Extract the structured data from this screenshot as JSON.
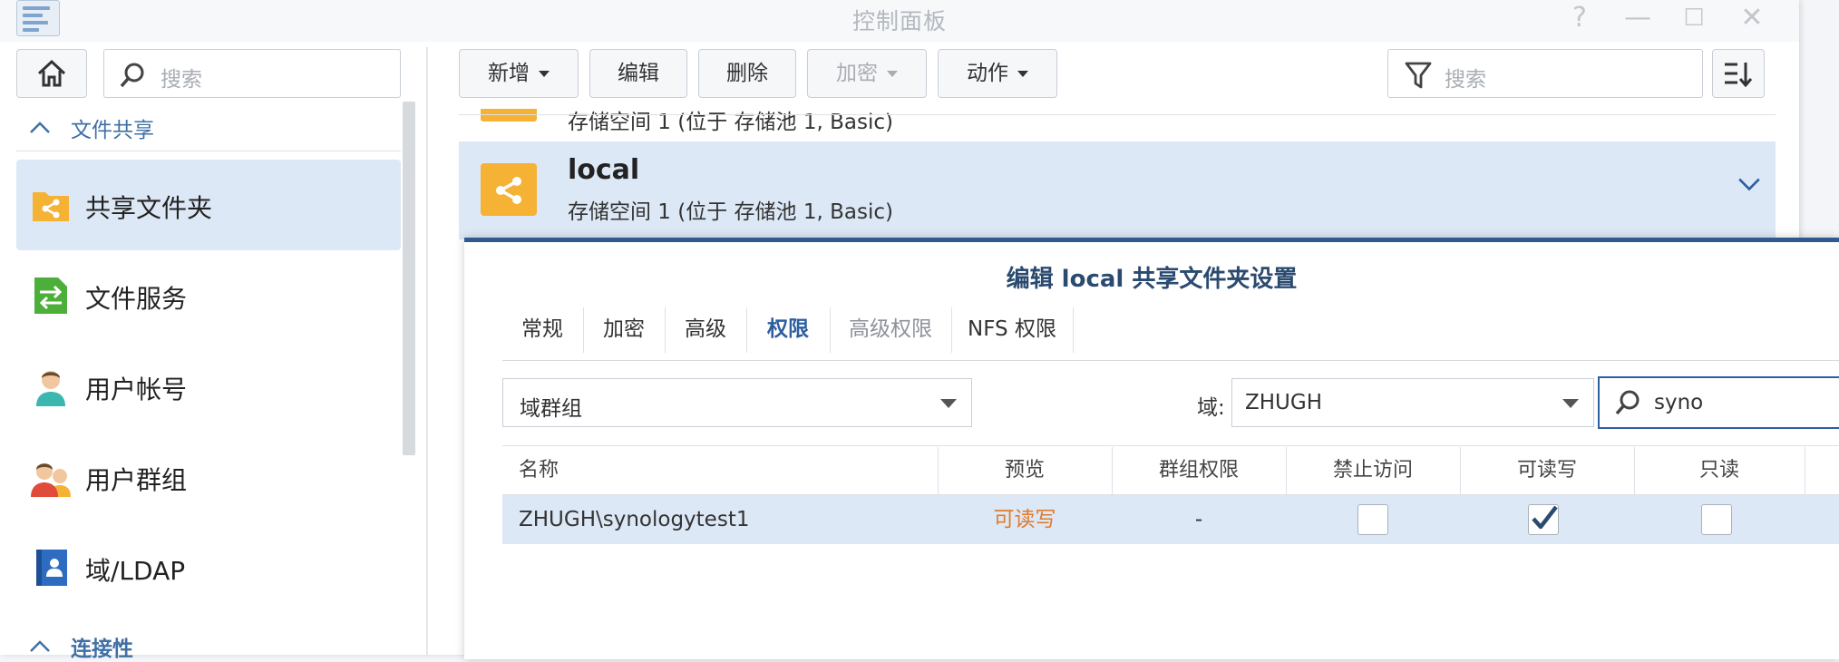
{
  "window": {
    "title": "控制面板",
    "controls": {
      "help": "?",
      "minimize": "—",
      "maximize": "☐",
      "close": "✕"
    }
  },
  "sidebar": {
    "search_placeholder": "搜索",
    "sections": [
      {
        "label": "文件共享",
        "state": "expanded"
      },
      {
        "label": "连接性",
        "state": "expanded"
      }
    ],
    "items": [
      {
        "label": "共享文件夹",
        "icon": "shared-folder-icon",
        "selected": true
      },
      {
        "label": "文件服务",
        "icon": "file-services-icon",
        "selected": false
      },
      {
        "label": "用户帐号",
        "icon": "user-account-icon",
        "selected": false
      },
      {
        "label": "用户群组",
        "icon": "user-group-icon",
        "selected": false
      },
      {
        "label": "域/LDAP",
        "icon": "domain-ldap-icon",
        "selected": false
      }
    ]
  },
  "toolbar": {
    "create_label": "新增",
    "edit_label": "编辑",
    "delete_label": "删除",
    "encrypt_label": "加密",
    "action_label": "动作",
    "filter_placeholder": "搜索"
  },
  "shared_folders": [
    {
      "name": "",
      "location": "存储空间 1 (位于 存储池 1, Basic)"
    },
    {
      "name": "local",
      "location": "存储空间 1 (位于 存储池 1, Basic)",
      "selected": true
    }
  ],
  "dialog": {
    "title": "编辑 local 共享文件夹设置",
    "tabs": [
      {
        "label": "常规",
        "state": "normal"
      },
      {
        "label": "加密",
        "state": "normal"
      },
      {
        "label": "高级",
        "state": "normal"
      },
      {
        "label": "权限",
        "state": "active"
      },
      {
        "label": "高级权限",
        "state": "disabled"
      },
      {
        "label": "NFS 权限",
        "state": "normal"
      }
    ],
    "principal_type": "域群组",
    "domain_label": "域:",
    "domain_value": "ZHUGH",
    "search_value": "syno",
    "table": {
      "headers": [
        "名称",
        "预览",
        "群组权限",
        "禁止访问",
        "可读写",
        "只读"
      ],
      "rows": [
        {
          "name": "ZHUGH\\synologytest1",
          "preview": "可读写",
          "group_permission": "-",
          "no_access": false,
          "read_write": true,
          "read_only": false
        }
      ]
    }
  },
  "colors": {
    "accent": "#2d5fa0",
    "section_header": "#3f6fa6",
    "selection": "#dde8f6",
    "folder": "#f5b235",
    "preview_text": "#e07b2a",
    "dialog_border": "#2f5a8f"
  }
}
